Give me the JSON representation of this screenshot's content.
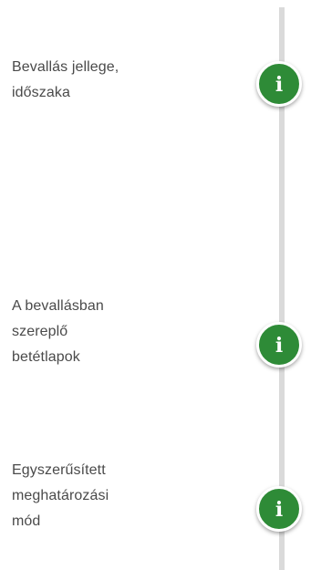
{
  "steps": [
    {
      "lines": [
        "Bevallás jellege,",
        "időszaka"
      ],
      "icon": "info-icon",
      "icon_glyph": "i"
    },
    {
      "lines": [
        "A bevallásban",
        "szereplő",
        "betétlapok"
      ],
      "icon": "info-icon",
      "icon_glyph": "i"
    },
    {
      "lines": [
        "Egyszerűsített",
        "meghatározási",
        "mód"
      ],
      "icon": "info-icon",
      "icon_glyph": "i"
    }
  ],
  "colors": {
    "accent": "#2e8b37",
    "line": "#dadada",
    "text": "#4a4a4a"
  }
}
